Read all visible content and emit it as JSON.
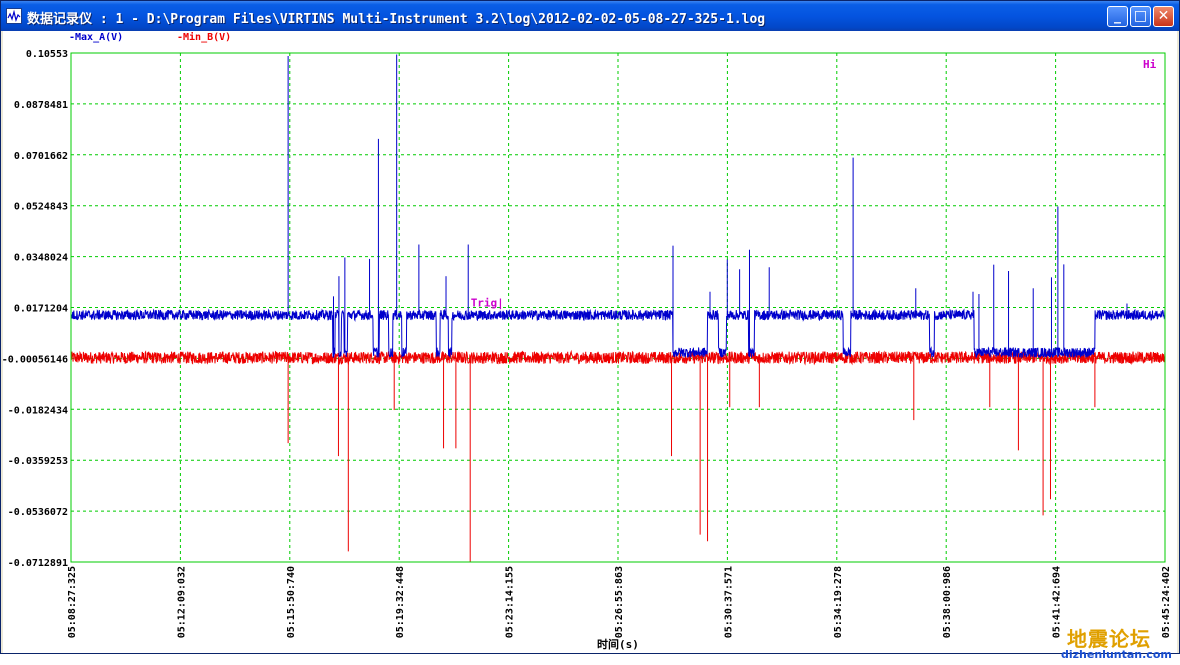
{
  "window": {
    "title": "数据记录仪 : 1 - D:\\Program Files\\VIRTINS Multi-Instrument 3.2\\log\\2012-02-02-05-08-27-325-1.log",
    "minimize_glyph": "_",
    "maximize_glyph": "□",
    "close_glyph": "✕"
  },
  "watermark": {
    "text": "地震论坛",
    "url": "dizhenluntan.com"
  },
  "chart_data": {
    "type": "line",
    "title": "",
    "xlabel": "时间(s)",
    "ylabel": "",
    "legend": [
      {
        "name": "-Max_A(V)",
        "color": "#0000cc"
      },
      {
        "name": "-Min_B(V)",
        "color": "#ee0000"
      }
    ],
    "legend_placement": "top-left",
    "y_ticks": [
      "0.10553",
      "0.0878481",
      "0.0701662",
      "0.0524843",
      "0.0348024",
      "0.0171204",
      "-0.00056146",
      "-0.0182434",
      "-0.0359253",
      "-0.0536072",
      "-0.0712891"
    ],
    "ylim": [
      -0.0712891,
      0.10553
    ],
    "x_ticks": [
      "05:08:27:325",
      "05:12:09:032",
      "05:15:50:740",
      "05:19:32:448",
      "05:23:14:155",
      "05:26:55:863",
      "05:30:37:571",
      "05:34:19:278",
      "05:38:00:986",
      "05:41:42:694",
      "05:45:24:402"
    ],
    "x_seconds_range": [
      0,
      2217.077
    ],
    "grid": true,
    "annotations": [
      {
        "text": "Trig|",
        "x": 810,
        "y": 0.0171
      },
      {
        "text": "Hi",
        "position": "top-right"
      }
    ],
    "series": [
      {
        "name": "-Max_A(V)",
        "color": "#0000cc",
        "baseline_segments": [
          [
            0,
            532,
            0.0145
          ],
          [
            532,
            592,
            0.0145
          ],
          [
            592,
            1218,
            0.0145
          ],
          [
            1218,
            2080,
            0.0145
          ],
          [
            2080,
            2217,
            0.0145
          ]
        ],
        "low_segments": [
          [
            530,
            535,
            0.0015
          ],
          [
            543,
            548,
            0.0015
          ],
          [
            553,
            560,
            0.0015
          ],
          [
            612,
            625,
            0.0015
          ],
          [
            644,
            652,
            0.0015
          ],
          [
            670,
            680,
            0.0015
          ],
          [
            740,
            748,
            0.0015
          ],
          [
            765,
            772,
            0.0015
          ],
          [
            1220,
            1290,
            0.0015
          ],
          [
            1312,
            1328,
            0.0015
          ],
          [
            1373,
            1385,
            0.0015
          ],
          [
            1565,
            1580,
            0.0015
          ],
          [
            1740,
            1750,
            0.0015
          ],
          [
            1830,
            2075,
            0.0015
          ]
        ],
        "spikes": [
          [
            440,
            0.1045
          ],
          [
            532,
            0.021
          ],
          [
            543,
            0.028
          ],
          [
            555,
            0.0345
          ],
          [
            605,
            0.034
          ],
          [
            623,
            0.0757
          ],
          [
            660,
            0.105
          ],
          [
            705,
            0.039
          ],
          [
            760,
            0.028
          ],
          [
            805,
            0.039
          ],
          [
            1220,
            0.0386
          ],
          [
            1295,
            0.0226
          ],
          [
            1330,
            0.0338
          ],
          [
            1355,
            0.0304
          ],
          [
            1375,
            0.0372
          ],
          [
            1415,
            0.0311
          ],
          [
            1585,
            0.0692
          ],
          [
            1712,
            0.0238
          ],
          [
            1828,
            0.0226
          ],
          [
            1840,
            0.0218
          ],
          [
            1870,
            0.032
          ],
          [
            1900,
            0.0298
          ],
          [
            1950,
            0.0238
          ],
          [
            1987,
            0.0276
          ],
          [
            2000,
            0.0522
          ],
          [
            2012,
            0.0321
          ],
          [
            2140,
            0.0185
          ]
        ]
      },
      {
        "name": "-Min_B(V)",
        "color": "#ee0000",
        "baseline_segments": [
          [
            0,
            2217,
            -0.0003
          ]
        ],
        "spikes": [
          [
            440,
            -0.03
          ],
          [
            542,
            -0.0345
          ],
          [
            562,
            -0.0676
          ],
          [
            655,
            -0.0185
          ],
          [
            755,
            -0.0318
          ],
          [
            780,
            -0.0318
          ],
          [
            809,
            -0.0712
          ],
          [
            1217,
            -0.0345
          ],
          [
            1275,
            -0.0618
          ],
          [
            1290,
            -0.0641
          ],
          [
            1335,
            -0.0175
          ],
          [
            1395,
            -0.0175
          ],
          [
            1708,
            -0.022
          ],
          [
            1862,
            -0.0175
          ],
          [
            1920,
            -0.0325
          ],
          [
            1970,
            -0.0551
          ],
          [
            1985,
            -0.0495
          ],
          [
            2075,
            -0.0175
          ]
        ]
      }
    ]
  }
}
